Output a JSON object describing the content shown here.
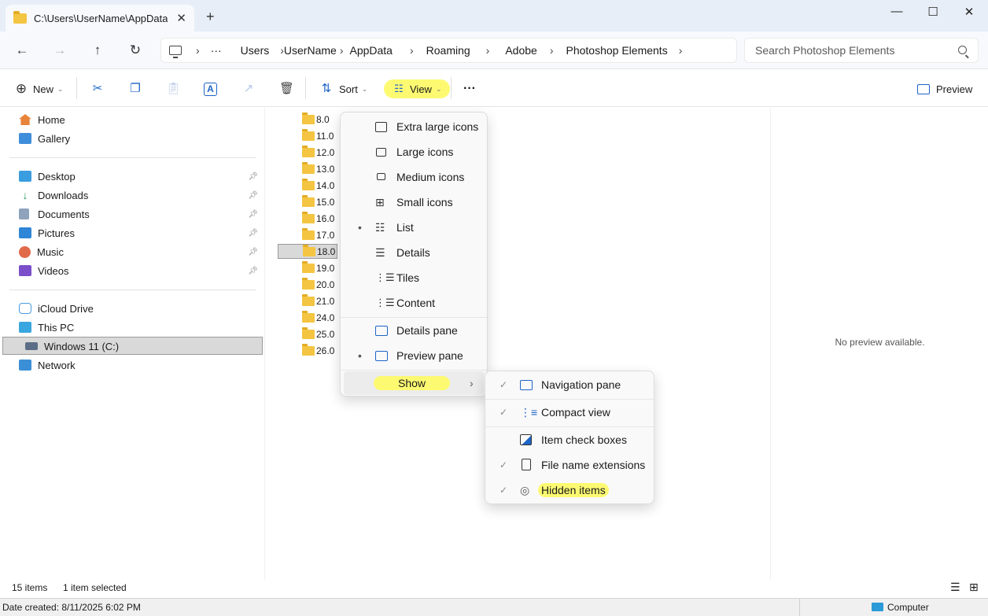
{
  "window": {
    "tab_title": "C:\\Users\\UserName\\AppData\\Ro",
    "tab_close": "✕",
    "new_tab": "+",
    "minimize": "—",
    "maximize": "☐",
    "close": "✕"
  },
  "nav": {
    "back": "←",
    "forward": "→",
    "up": "↑",
    "refresh": "↻",
    "more_crumbs": "···",
    "breadcrumbs": [
      "Users",
      "UserName",
      "AppData",
      "Roaming",
      "Adobe",
      "Photoshop Elements"
    ],
    "search_placeholder": "Search Photoshop Elements"
  },
  "toolbar": {
    "new_label": "New",
    "sort_label": "Sort",
    "view_label": "View",
    "more": "···",
    "preview_label": "Preview"
  },
  "sidebar": {
    "top_items": [
      "Home",
      "Gallery"
    ],
    "pinned_items": [
      "Desktop",
      "Downloads",
      "Documents",
      "Pictures",
      "Music",
      "Videos"
    ],
    "drive_items": [
      "iCloud Drive",
      "This PC",
      "Windows 11 (C:)",
      "Network"
    ]
  },
  "files": [
    "8.0",
    "11.0",
    "12.0",
    "13.0",
    "14.0",
    "15.0",
    "16.0",
    "17.0",
    "18.0",
    "19.0",
    "20.0",
    "21.0",
    "24.0",
    "25.0",
    "26.0"
  ],
  "selected_file": "18.0",
  "preview": {
    "message": "No preview available."
  },
  "status": {
    "item_count": "15 items",
    "selection": "1 item selected",
    "date_created": "Date created: 8/11/2025 6:02 PM",
    "location": "Computer"
  },
  "view_menu": {
    "items": [
      {
        "label": "Extra large icons",
        "icon": "extra-large-icons-icon",
        "bullet": false
      },
      {
        "label": "Large icons",
        "icon": "large-icons-icon",
        "bullet": false
      },
      {
        "label": "Medium icons",
        "icon": "medium-icons-icon",
        "bullet": false
      },
      {
        "label": "Small icons",
        "icon": "small-icons-icon",
        "bullet": false
      },
      {
        "label": "List",
        "icon": "list-icon",
        "bullet": true
      },
      {
        "label": "Details",
        "icon": "details-icon",
        "bullet": false
      },
      {
        "label": "Tiles",
        "icon": "tiles-icon",
        "bullet": false
      },
      {
        "label": "Content",
        "icon": "content-icon",
        "bullet": false
      }
    ],
    "pane_items": [
      {
        "label": "Details pane",
        "bullet": false
      },
      {
        "label": "Preview pane",
        "bullet": true
      }
    ],
    "show_label": "Show",
    "bullet_char": "•",
    "submenu_arrow": "›"
  },
  "show_menu": {
    "items": [
      {
        "label": "Navigation pane",
        "checked": true
      },
      {
        "label": "Compact view",
        "checked": true
      },
      {
        "label": "Item check boxes",
        "checked": false
      },
      {
        "label": "File name extensions",
        "checked": true
      },
      {
        "label": "Hidden items",
        "checked": true
      }
    ],
    "check_char": "✓"
  },
  "colors": {
    "highlight": "#fdfa72",
    "accent": "#1d64c7",
    "folder": "#f4c542"
  }
}
